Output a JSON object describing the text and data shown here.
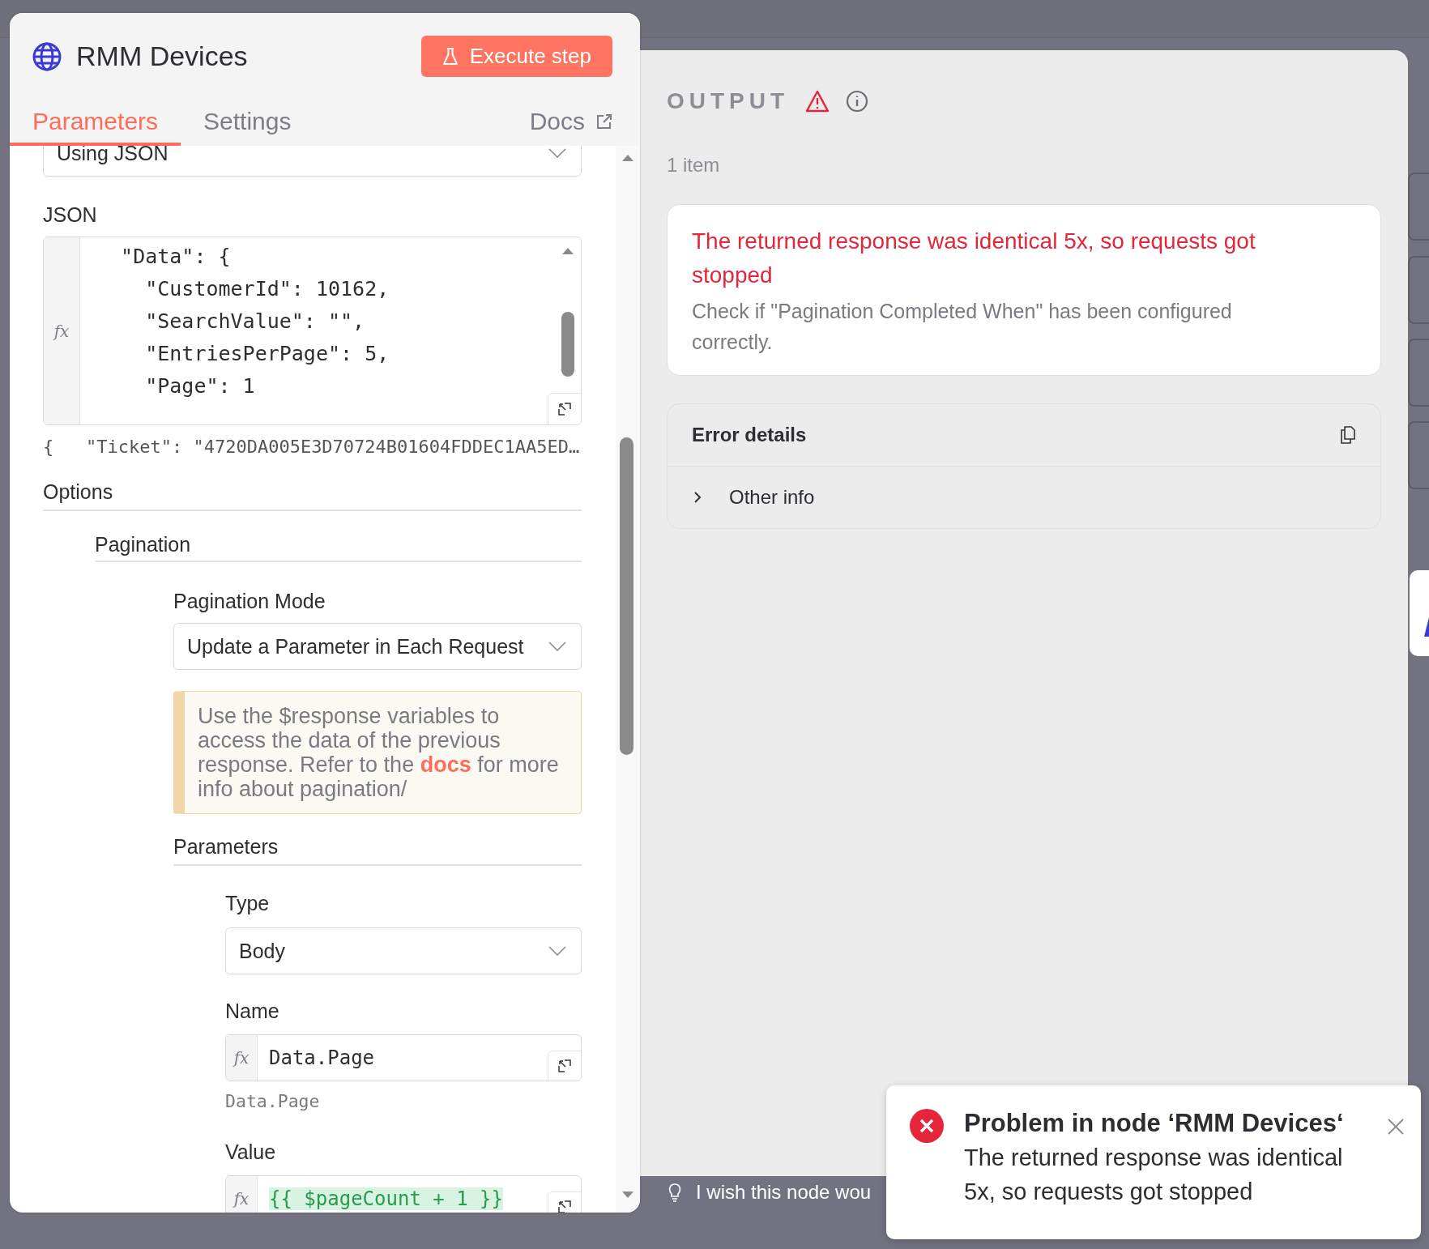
{
  "node_panel": {
    "title": "RMM Devices",
    "execute_button": "Execute step",
    "tabs": [
      {
        "label": "Parameters",
        "selected": true
      },
      {
        "label": "Settings",
        "selected": false
      }
    ],
    "docs_link": "Docs",
    "body_select": {
      "value": "Using JSON"
    },
    "json_field": {
      "label": "JSON",
      "prefix": "fx",
      "lines": [
        "  \"Data\": {",
        "    \"CustomerId\": 10162,",
        "    \"SearchValue\": \"\",",
        "    \"EntriesPerPage\": 5,",
        "    \"Page\": 1"
      ],
      "preview": "{   \"Ticket\": \"4720DA005E3D70724B01604FDDEC1AA5ED…"
    },
    "options": {
      "label": "Options",
      "pagination": {
        "label": "Pagination",
        "mode": {
          "label": "Pagination Mode",
          "value": "Update a Parameter in Each Request"
        },
        "notice": {
          "before": "Use the $response variables to access the data of the previous response. Refer to the ",
          "link": "docs",
          "after": " for more info about pagination/"
        },
        "parameters": {
          "label": "Parameters",
          "type": {
            "label": "Type",
            "value": "Body"
          },
          "name": {
            "label": "Name",
            "prefix": "fx",
            "value": "Data.Page",
            "hint": "Data.Page"
          },
          "value": {
            "label": "Value",
            "prefix": "fx",
            "value": "{{ $pageCount + 1 }}"
          }
        }
      }
    }
  },
  "output_panel": {
    "title": "OUTPUT",
    "count": "1 item",
    "error": {
      "title": "The returned response was identical 5x, so requests got stopped",
      "description": "Check if \"Pagination Completed When\" has been configured correctly."
    },
    "details": {
      "title": "Error details",
      "rows": [
        {
          "label": "Other info",
          "expanded": false
        }
      ]
    }
  },
  "feedback_bar": {
    "text": "I wish this node wou"
  },
  "toast": {
    "title": "Problem in node ‘RMM Devices‘",
    "message": "The returned response was identical 5x, so requests got stopped"
  }
}
